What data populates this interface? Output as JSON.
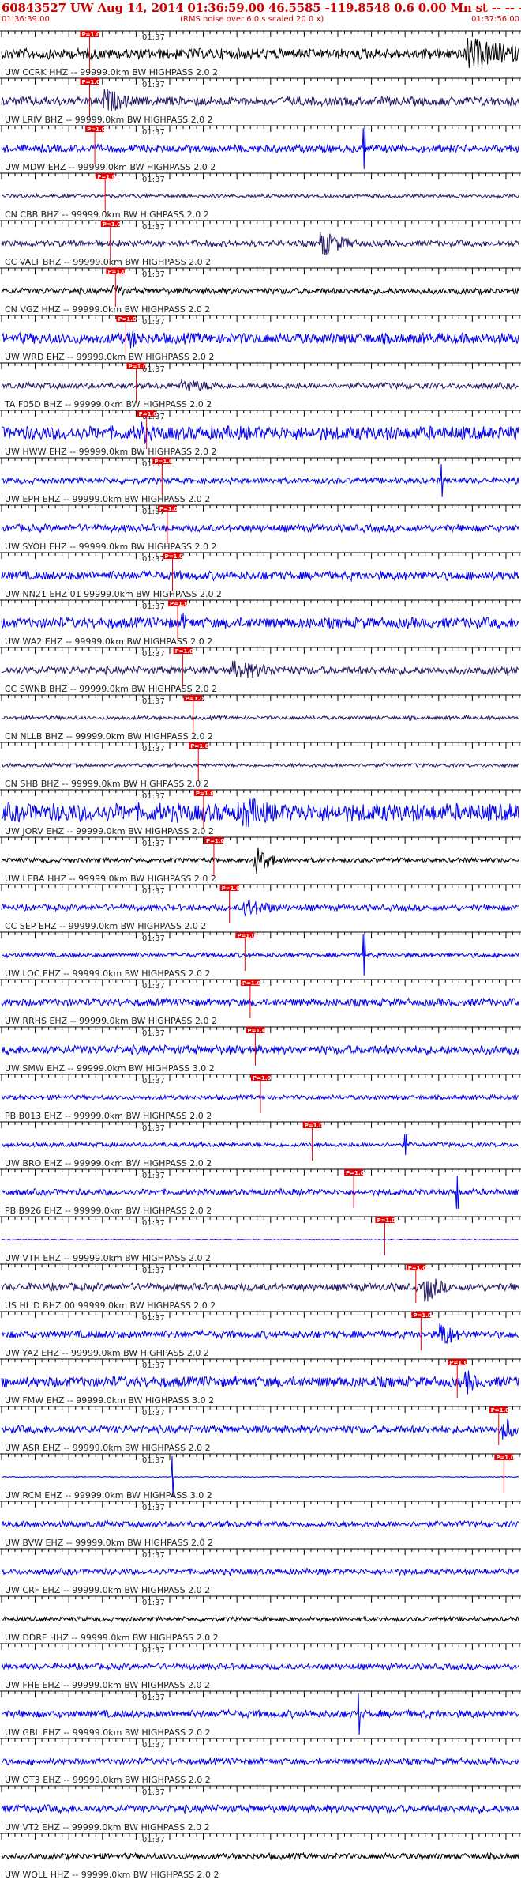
{
  "header": {
    "title": "60843527 UW Aug 14, 2014 01:36:59.00   46.5585 -119.8548  0.6 0.00 Mn st -- -- --  -1",
    "start_time": "01:36:39.00",
    "end_time": "01:37:56.00",
    "note": "(RMS noise over 6.0 s scaled 20.0 x)"
  },
  "colors": {
    "header_text": "#cc0000",
    "axis": "#000000",
    "trace_blue": "#0000ee",
    "trace_navy": "#221a66",
    "trace_black": "#000000",
    "pick": "#ee0000",
    "label": "#222222"
  },
  "time_mark": "01:37",
  "pick_label": "P=1.0",
  "panels": [
    {
      "label": "UW CCRK HHZ -- 99999.0km BW  HIGHPASS  2.0  2",
      "color": "trace_black",
      "amp": 0.35,
      "event": {
        "t": 0.9,
        "amp": 1.0,
        "width": 0.12
      },
      "pick": 0.17
    },
    {
      "label": "UW LRIV BHZ -- 99999.0km BW  HIGHPASS  2.0  2",
      "color": "trace_navy",
      "amp": 0.3,
      "event": {
        "t": 0.2,
        "amp": 0.8,
        "width": 0.05
      },
      "pick": 0.17
    },
    {
      "label": "UW MDW EHZ -- 99999.0km BW  HIGHPASS  2.0  2",
      "color": "trace_blue",
      "amp": 0.25,
      "spike": {
        "t": 0.7,
        "amp": 1.0
      },
      "pick": 0.18
    },
    {
      "label": "CN CBB BHZ -- 99999.0km BW  HIGHPASS  2.0  2",
      "color": "trace_navy",
      "amp": 0.12,
      "pick": 0.2
    },
    {
      "label": "CC VALT BHZ -- 99999.0km BW  HIGHPASS  2.0  2",
      "color": "trace_navy",
      "amp": 0.2,
      "event": {
        "t": 0.62,
        "amp": 0.8,
        "width": 0.05
      },
      "pick": 0.21
    },
    {
      "label": "CN VGZ HHZ -- 99999.0km BW  HIGHPASS  2.0  2",
      "color": "trace_black",
      "amp": 0.2,
      "event": {
        "t": 0.22,
        "amp": 0.5,
        "width": 0.02
      },
      "pick": 0.22
    },
    {
      "label": "UW WRD EHZ -- 99999.0km BW  HIGHPASS  2.0  2",
      "color": "trace_blue",
      "amp": 0.35,
      "event": {
        "t": 0.25,
        "amp": 0.6,
        "width": 0.04
      },
      "pick": 0.24
    },
    {
      "label": "TA F05D BHZ -- 99999.0km BW  HIGHPASS  2.0  2",
      "color": "trace_navy",
      "amp": 0.2,
      "event": {
        "t": 0.35,
        "amp": 0.4,
        "width": 0.1
      },
      "pick": 0.26
    },
    {
      "label": "UW HWW EHZ -- 99999.0km BW  HIGHPASS  2.0  2",
      "color": "trace_blue",
      "amp": 0.45,
      "event": {
        "t": 0.27,
        "amp": 0.8,
        "width": 0.02
      },
      "pick": 0.28
    },
    {
      "label": "UW EPH EHZ -- 99999.0km BW  HIGHPASS  2.0  2",
      "color": "trace_blue",
      "amp": 0.2,
      "spike": {
        "t": 0.85,
        "amp": 0.8
      },
      "pick": 0.31
    },
    {
      "label": "UW SYOH EHZ -- 99999.0km BW  HIGHPASS  2.0  2",
      "color": "trace_blue",
      "amp": 0.25,
      "pick": 0.32
    },
    {
      "label": "UW NN21 EHZ 01 99999.0km BW  HIGHPASS  2.0  2",
      "color": "trace_blue",
      "amp": 0.3,
      "pick": 0.33
    },
    {
      "label": "UW WA2 EHZ -- 99999.0km BW  HIGHPASS  2.0  2",
      "color": "trace_blue",
      "amp": 0.35,
      "event": {
        "t": 0.35,
        "amp": 0.6,
        "width": 0.02
      },
      "pick": 0.34
    },
    {
      "label": "CC SWNB BHZ -- 99999.0km BW  HIGHPASS  2.0  2",
      "color": "trace_navy",
      "amp": 0.25,
      "event": {
        "t": 0.45,
        "amp": 0.6,
        "width": 0.1
      },
      "pick": 0.35
    },
    {
      "label": "CN NLLB BHZ -- 99999.0km BW  HIGHPASS  2.0  2",
      "color": "trace_navy",
      "amp": 0.12,
      "pick": 0.37
    },
    {
      "label": "CN SHB BHZ -- 99999.0km BW  HIGHPASS  2.0  2",
      "color": "trace_navy",
      "amp": 0.12,
      "pick": 0.38
    },
    {
      "label": "UW JORV EHZ -- 99999.0km BW  HIGHPASS  2.0  2",
      "color": "trace_blue",
      "amp": 0.6,
      "event": {
        "t": 0.47,
        "amp": 1.0,
        "width": 0.08
      },
      "pick": 0.39
    },
    {
      "label": "UW LEBA HHZ -- 99999.0km BW  HIGHPASS  2.0  2",
      "color": "trace_black",
      "amp": 0.15,
      "event": {
        "t": 0.49,
        "amp": 0.9,
        "width": 0.03
      },
      "pick": 0.41
    },
    {
      "label": "CC SEP EHZ -- 99999.0km BW  HIGHPASS  2.0  2",
      "color": "trace_blue",
      "amp": 0.2,
      "event": {
        "t": 0.47,
        "amp": 0.6,
        "width": 0.06
      },
      "pick": 0.44
    },
    {
      "label": "UW LOC EHZ -- 99999.0km BW  HIGHPASS  2.0  2",
      "color": "trace_blue",
      "amp": 0.15,
      "spike": {
        "t": 0.7,
        "amp": 1.0
      },
      "pick": 0.47
    },
    {
      "label": "UW RRHS EHZ -- 99999.0km BW  HIGHPASS  2.0  2",
      "color": "trace_blue",
      "amp": 0.25,
      "pick": 0.48
    },
    {
      "label": "UW SMW EHZ -- 99999.0km BW  HIGHPASS  3.0  2",
      "color": "trace_blue",
      "amp": 0.3,
      "pick": 0.49
    },
    {
      "label": "PB B013 EHZ -- 99999.0km BW  HIGHPASS  2.0  2",
      "color": "trace_blue",
      "amp": 0.15,
      "pick": 0.5
    },
    {
      "label": "UW BRO EHZ -- 99999.0km BW  HIGHPASS  2.0  2",
      "color": "trace_blue",
      "amp": 0.15,
      "spike": {
        "t": 0.78,
        "amp": 0.5
      },
      "pick": 0.6
    },
    {
      "label": "PB B926 EHZ -- 99999.0km BW  HIGHPASS  2.0  2",
      "color": "trace_blue",
      "amp": 0.2,
      "spike": {
        "t": 0.88,
        "amp": 0.8
      },
      "pick": 0.68
    },
    {
      "label": "UW VTH EHZ -- 99999.0km BW  HIGHPASS  2.0  2",
      "color": "trace_blue",
      "amp": 0.03,
      "pick": 0.74
    },
    {
      "label": "US HLID BHZ 00 99999.0km BW  HIGHPASS  2.0  2",
      "color": "trace_navy",
      "amp": 0.25,
      "event": {
        "t": 0.82,
        "amp": 1.0,
        "width": 0.03
      },
      "pick": 0.8
    },
    {
      "label": "UW YA2 EHZ -- 99999.0km BW  HIGHPASS  2.0  2",
      "color": "trace_blue",
      "amp": 0.25,
      "event": {
        "t": 0.85,
        "amp": 0.9,
        "width": 0.03
      },
      "pick": 0.81
    },
    {
      "label": "UW FMW EHZ -- 99999.0km BW  HIGHPASS  3.0  2",
      "color": "trace_blue",
      "amp": 0.35,
      "event": {
        "t": 0.9,
        "amp": 0.8,
        "width": 0.02
      },
      "pick": 0.88
    },
    {
      "label": "UW ASR EHZ -- 99999.0km BW  HIGHPASS  2.0  2",
      "color": "trace_blue",
      "amp": 0.25,
      "event": {
        "t": 0.97,
        "amp": 0.9,
        "width": 0.02
      },
      "pick": 0.96
    },
    {
      "label": "UW RCM EHZ -- 99999.0km BW  HIGHPASS  3.0  2",
      "color": "trace_blue",
      "amp": 0.03,
      "spike": {
        "t": 0.33,
        "amp": 1.0
      },
      "pick": 0.97
    },
    {
      "label": "UW BVW EHZ -- 99999.0km BW  HIGHPASS  2.0  2",
      "color": "trace_blue",
      "amp": 0.2
    },
    {
      "label": "UW CRF EHZ -- 99999.0km BW  HIGHPASS  2.0  2",
      "color": "trace_blue",
      "amp": 0.2
    },
    {
      "label": "UW DDRF HHZ -- 99999.0km BW  HIGHPASS  2.0  2",
      "color": "trace_black",
      "amp": 0.15
    },
    {
      "label": "UW FHE EHZ -- 99999.0km BW  HIGHPASS  2.0  2",
      "color": "trace_blue",
      "amp": 0.2
    },
    {
      "label": "UW GBL EHZ -- 99999.0km BW  HIGHPASS  2.0  2",
      "color": "trace_blue",
      "amp": 0.25,
      "spike": {
        "t": 0.69,
        "amp": 1.0
      }
    },
    {
      "label": "UW OT3 EHZ -- 99999.0km BW  HIGHPASS  2.0  2",
      "color": "trace_blue",
      "amp": 0.2
    },
    {
      "label": "UW VT2 EHZ -- 99999.0km BW  HIGHPASS  2.0  2",
      "color": "trace_blue",
      "amp": 0.25
    },
    {
      "label": "UW WOLL HHZ -- 99999.0km BW  HIGHPASS  2.0  2",
      "color": "trace_black",
      "amp": 0.2
    }
  ]
}
